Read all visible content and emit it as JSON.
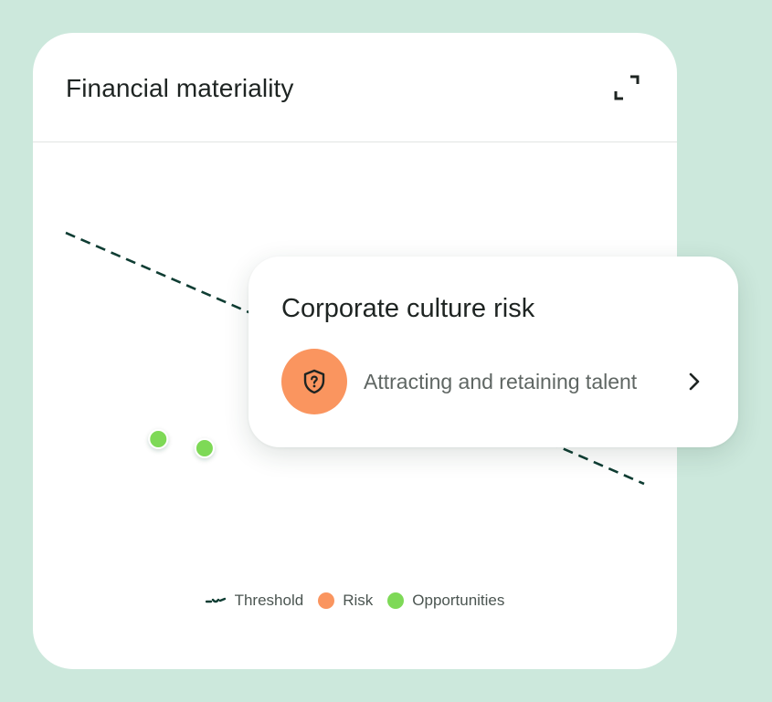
{
  "card": {
    "title": "Financial materiality",
    "expand_icon": "expand-icon"
  },
  "chart_data": {
    "type": "scatter",
    "title": "Financial materiality",
    "series": [
      {
        "name": "Opportunities",
        "color": "#7ed957",
        "points": [
          {
            "x": 1.6,
            "y": 4.3
          },
          {
            "x": 2.4,
            "y": 4.1
          }
        ]
      },
      {
        "name": "Risk",
        "color": "#fa955f",
        "points": []
      }
    ],
    "threshold": {
      "name": "Threshold",
      "color": "#0f3d33",
      "style": "dashed"
    },
    "legend": [
      "Threshold",
      "Risk",
      "Opportunities"
    ],
    "legend_position": "bottom",
    "grid": false
  },
  "legend": {
    "threshold": "Threshold",
    "risk": "Risk",
    "opportunities": "Opportunities"
  },
  "colors": {
    "risk": "#fa955f",
    "opportunity": "#7ed957",
    "threshold": "#0f3d33",
    "background": "#cce8dc"
  },
  "popup": {
    "title": "Corporate culture risk",
    "item_label": "Attracting and retaining talent",
    "item_icon": "shield-question-icon",
    "chevron_icon": "chevron-right-icon"
  }
}
